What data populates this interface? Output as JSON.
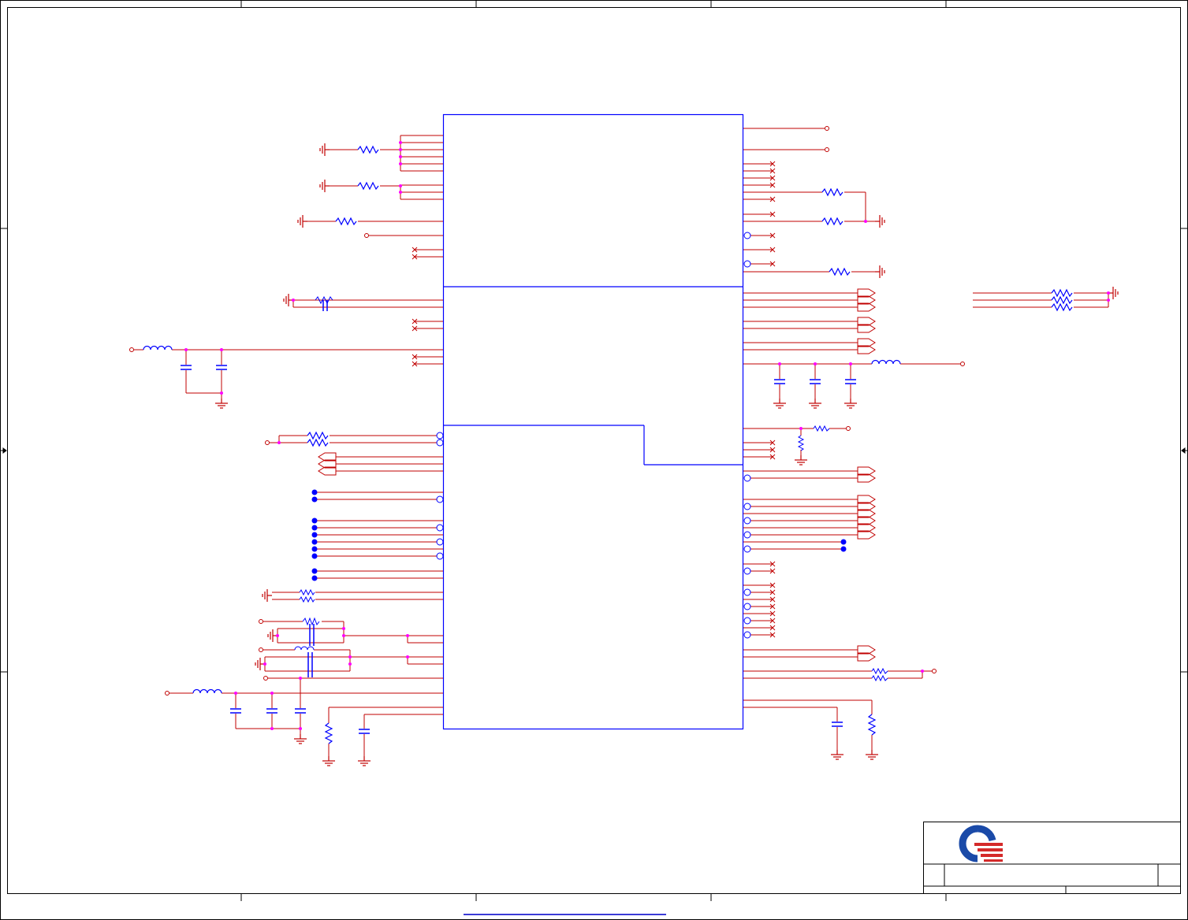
{
  "diagram": {
    "type": "schematic",
    "colors": {
      "border": "#000000",
      "part": "#0000ff",
      "wire": "#c00000",
      "junction": "#ff00ff",
      "link": "#3b3bd6"
    },
    "title_block": {
      "logo": "quanta-logo"
    }
  }
}
